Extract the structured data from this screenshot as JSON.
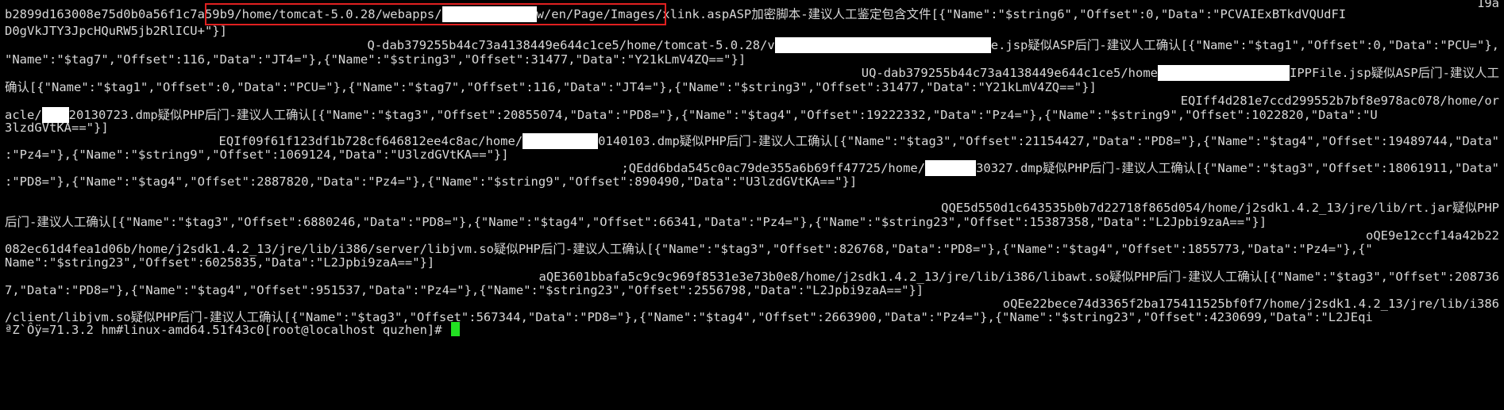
{
  "terminal": {
    "lines": [
      {
        "a": "19a"
      },
      {
        "a": "b2899d163008e75d0b0a56f1c7a59b9",
        "b": "/home/tomcat-5.0.28/webapps/",
        "c": "w/en/Page/Images/xlink.asp",
        "d": "ASP加密脚本-建议人工鉴定包含文件[{\"Name\":\"$string6\",\"Offset\":0,\"Data\":\"PCVAIExBTkdVQUdFI"
      },
      {
        "a": "D0gVkJTY3JpcHQuRW5jb2RlICU+\"}]"
      },
      {
        "a": "Q-dab379255b44c73a4138449e644c1ce5/home/tomcat-5.0.28/v",
        "b": "e.jsp疑似ASP后门-建议人工确认[{\"Name\":\"$tag1\",\"Offset\":0,\"Data\":\"PCU=\"},"
      },
      {
        "a": "\"Name\":\"$tag7\",\"Offset\":116,\"Data\":\"JT4=\"},{\"Name\":\"$string3\",\"Offset\":31477,\"Data\":\"Y21kLmV4ZQ==\"}]"
      },
      {
        "a": "UQ-dab379255b44c73a4138449e644c1ce5/home",
        "b": "IPPFile.jsp疑似ASP后门-建议人工"
      },
      {
        "a": "确认[{\"Name\":\"$tag1\",\"Offset\":0,\"Data\":\"PCU=\"},{\"Name\":\"$tag7\",\"Offset\":116,\"Data\":\"JT4=\"},{\"Name\":\"$string3\",\"Offset\":31477,\"Data\":\"Y21kLmV4ZQ==\"}]"
      },
      {
        "a": "EQIff4d281e7ccd299552b7bf8e978ac078/home/or"
      },
      {
        "a": "acle/",
        "b": "20130723.dmp疑似PHP后门-建议人工确认[{\"Name\":\"$tag3\",\"Offset\":20855074,\"Data\":\"PD8=\"},{\"Name\":\"$tag4\",\"Offset\":19222332,\"Data\":\"Pz4=\"},{\"Name\":\"$string9\",\"Offset\":1022820,\"Data\":\"U"
      },
      {
        "a": "3lzdGVtKA==\"}]"
      },
      {
        "a": "EQIf09f61f123df1b728cf646812ee4c8ac/home/",
        "b": "0140103.dmp疑似PHP后门-建议人工确认[{\"Name\":\"$tag3\",\"Offset\":21154427,\"Data\":\"PD8=\"},{\"Name\":\"$tag4\",\"Offset\":19489744,\"Data\""
      },
      {
        "a": ":\"Pz4=\"},{\"Name\":\"$string9\",\"Offset\":1069124,\"Data\":\"U3lzdGVtKA==\"}]"
      },
      {
        "a": ";QEdd6bda545c0ac79de355a6b69ff47725/home/",
        "b": "30327.dmp疑似PHP后门-建议人工确认[{\"Name\":\"$tag3\",\"Offset\":18061911,\"Data\""
      },
      {
        "a": ":\"PD8=\"},{\"Name\":\"$tag4\",\"Offset\":2887820,\"Data\":\"Pz4=\"},{\"Name\":\"$string9\",\"Offset\":890490,\"Data\":\"U3lzdGVtKA==\"}]"
      },
      {
        "a": "QQE5d550d1c643535b0b7d22718f865d054/home/j2sdk1.4.2_13/jre/lib/rt.jar疑似PHP"
      },
      {
        "a": "后门-建议人工确认[{\"Name\":\"$tag3\",\"Offset\":6880246,\"Data\":\"PD8=\"},{\"Name\":\"$tag4\",\"Offset\":66341,\"Data\":\"Pz4=\"},{\"Name\":\"$string23\",\"Offset\":15387358,\"Data\":\"L2Jpbi9zaA==\"}]"
      },
      {
        "a": "oQE9e12ccf14a42b22"
      },
      {
        "a": "082ec61d4fea1d06b/home/j2sdk1.4.2_13/jre/lib/i386/server/libjvm.so疑似PHP后门-建议人工确认[{\"Name\":\"$tag3\",\"Offset\":826768,\"Data\":\"PD8=\"},{\"Name\":\"$tag4\",\"Offset\":1855773,\"Data\":\"Pz4=\"},{\""
      },
      {
        "a": "Name\":\"$string23\",\"Offset\":6025835,\"Data\":\"L2Jpbi9zaA==\"}]"
      },
      {
        "a": "aQE3601bbafa5c9c9c969f8531e3e73b0e8/home/j2sdk1.4.2_13/jre/lib/i386/libawt.so疑似PHP后门-建议人工确认[{\"Name\":\"$tag3\",\"Offset\":208736"
      },
      {
        "a": "7,\"Data\":\"PD8=\"},{\"Name\":\"$tag4\",\"Offset\":951537,\"Data\":\"Pz4=\"},{\"Name\":\"$string23\",\"Offset\":2556798,\"Data\":\"L2Jpbi9zaA==\"}]"
      },
      {
        "a": "oQEe22bece74d3365f2ba175411525bf0f7/home/j2sdk1.4.2_13/jre/lib/i386"
      },
      {
        "a": "/client/libjvm.so疑似PHP后门-建议人工确认[{\"Name\":\"$tag3\",\"Offset\":567344,\"Data\":\"PD8=\"},{\"Name\":\"$tag4\",\"Offset\":2663900,\"Data\":\"Pz4=\"},{\"Name\":\"$string23\",\"Offset\":4230699,\"Data\":\"L2JEqi"
      }
    ],
    "prompt": {
      "garbage": "ªZ`Ôÿ=71.3.2 hm#linux-amd64.51f43c0",
      "text": "[root@localhost quzhen]# "
    },
    "colors": {
      "background": "#000000",
      "text": "#d8d8d8",
      "highlight_box": "#e02020",
      "redaction": "#ffffff",
      "cursor": "#22e022"
    }
  }
}
